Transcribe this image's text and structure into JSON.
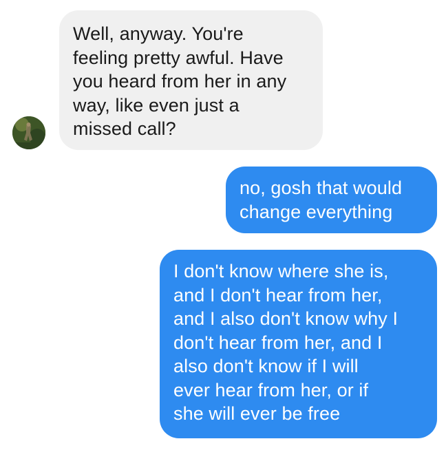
{
  "conversation": {
    "messages": [
      {
        "sender": "other",
        "text": "Well, anyway. You're\nfeeling pretty awful. Have\nyou heard from her in any\nway, like even just a\nmissed call?"
      },
      {
        "sender": "me",
        "text": "no, gosh that would\nchange everything"
      },
      {
        "sender": "me",
        "text": "I don't know where she is,\nand I don't hear from her,\nand I also don't know why I\ndon't hear from her, and I\nalso don't know if I will\never hear from her, or if\nshe will ever be free"
      }
    ]
  },
  "colors": {
    "incoming_bubble": "#f0f0f0",
    "outgoing_bubble": "#2e8bf0",
    "incoming_text": "#1a1a1a",
    "outgoing_text": "#ffffff"
  },
  "icons": {
    "avatar": "contact-avatar"
  }
}
